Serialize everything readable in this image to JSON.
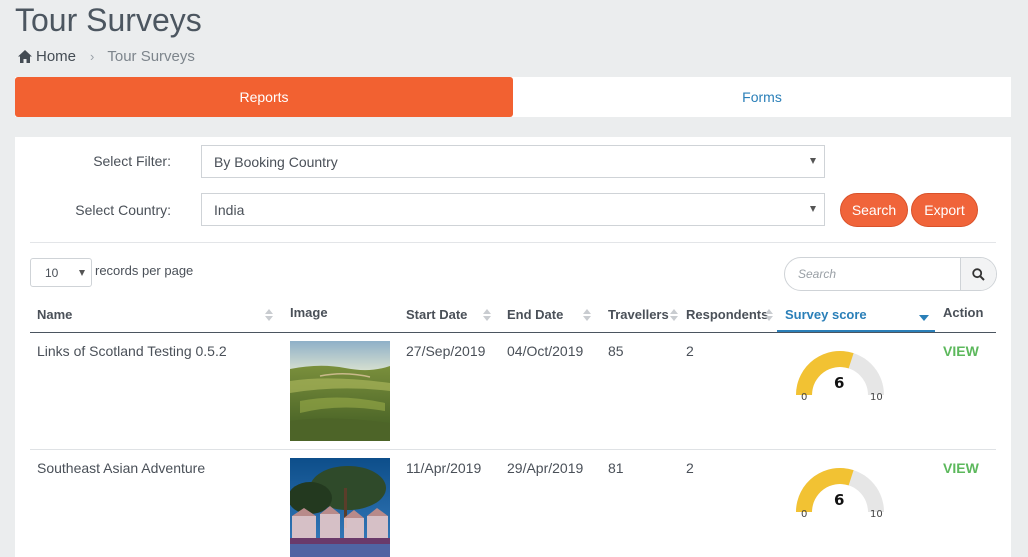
{
  "page": {
    "title": "Tour Surveys"
  },
  "breadcrumb": {
    "home": "Home",
    "separator": "›",
    "current": "Tour Surveys",
    "home_icon": "home-icon"
  },
  "tabs": [
    {
      "label": "Reports",
      "active": true
    },
    {
      "label": "Forms",
      "active": false
    }
  ],
  "filters": {
    "filter_label": "Select Filter:",
    "filter_value": "By Booking Country",
    "country_label": "Select Country:",
    "country_value": "India"
  },
  "actions": {
    "search_label": "Search",
    "export_label": "Export"
  },
  "table_controls": {
    "per_page_value": "10",
    "per_page_label": "records per page",
    "search_placeholder": "Search",
    "search_icon": "search-icon"
  },
  "columns": [
    "Name",
    "Image",
    "Start Date",
    "End Date",
    "Travellers",
    "Respondents",
    "Survey score",
    "Action"
  ],
  "rows": [
    {
      "name": "Links of Scotland Testing 0.5.2",
      "image": "golf-course-landscape",
      "start_date": "27/Sep/2019",
      "end_date": "04/Oct/2019",
      "travellers": "85",
      "respondents": "2",
      "score": 6,
      "score_text": "6",
      "score_min": "0",
      "score_max": "10",
      "action": "VIEW"
    },
    {
      "name": "Southeast Asian Adventure",
      "image": "resort-pool-night",
      "start_date": "11/Apr/2019",
      "end_date": "29/Apr/2019",
      "travellers": "81",
      "respondents": "2",
      "score": 6,
      "score_text": "6",
      "score_min": "0",
      "score_max": "10",
      "action": "VIEW"
    }
  ],
  "colors": {
    "accent": "#f26131",
    "link": "#2a7fb8",
    "view": "#5cb85c",
    "gauge_fill": "#f2c233",
    "gauge_track": "#e6e6e6"
  }
}
